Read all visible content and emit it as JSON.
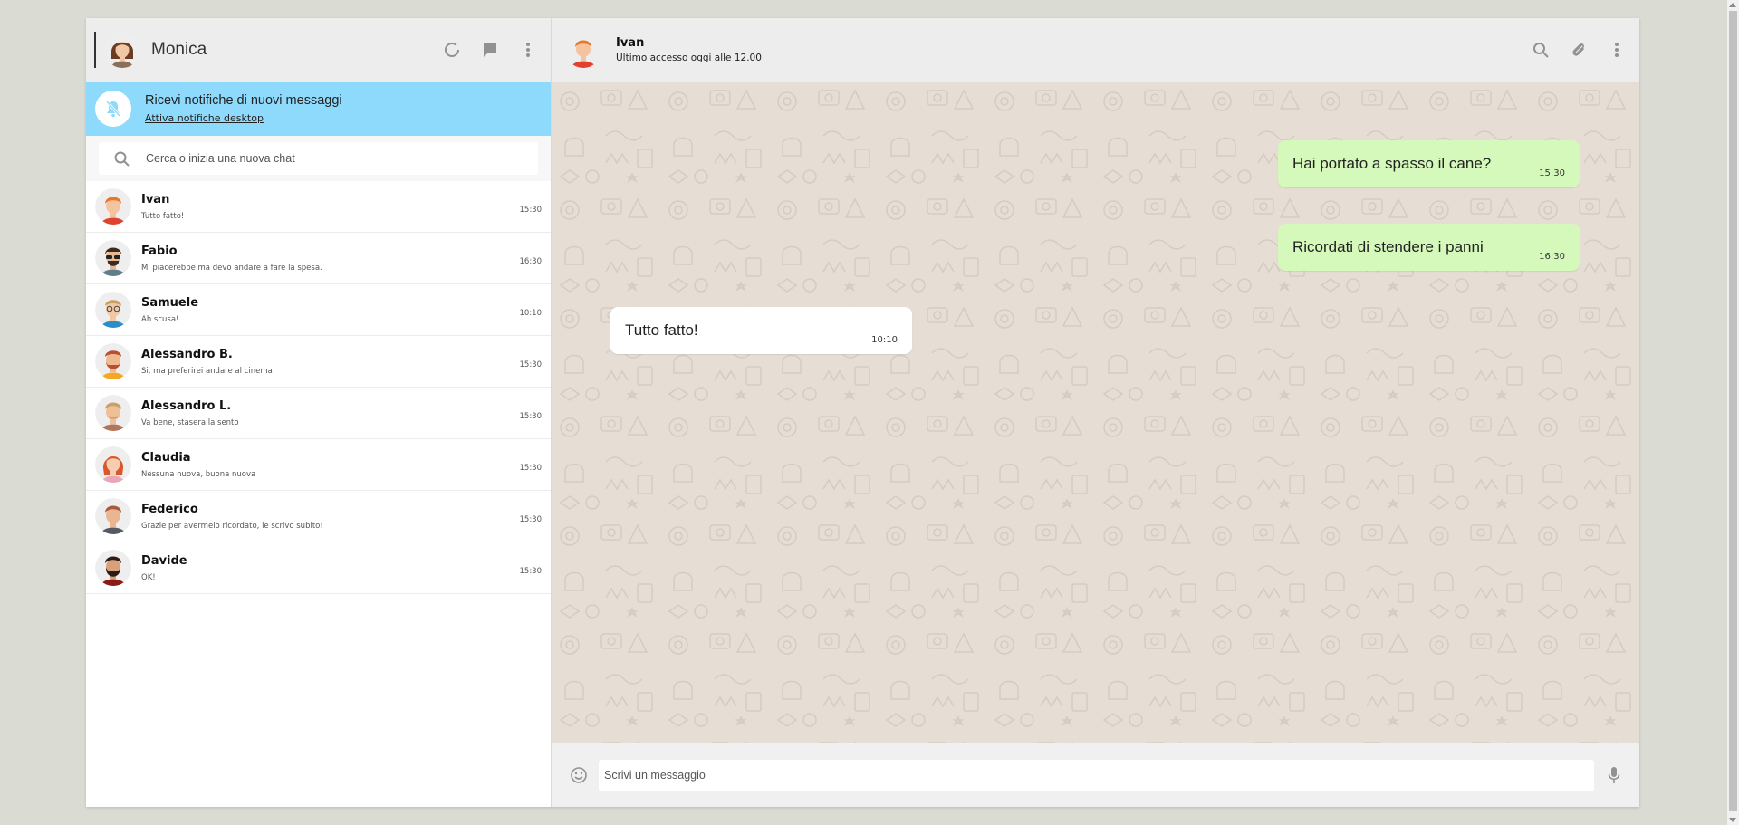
{
  "me": {
    "name": "Monica"
  },
  "notification": {
    "title": "Ricevi notifiche di nuovi messaggi",
    "link": "Attiva notifiche desktop"
  },
  "search": {
    "placeholder": "Cerca o inizia una nuova chat"
  },
  "chats": [
    {
      "name": "Ivan",
      "preview": "Tutto fatto!",
      "time": "15:30"
    },
    {
      "name": "Fabio",
      "preview": "Mi piacerebbe ma devo andare a fare la spesa.",
      "time": "16:30"
    },
    {
      "name": "Samuele",
      "preview": "Ah scusa!",
      "time": "10:10"
    },
    {
      "name": "Alessandro B.",
      "preview": "Si, ma preferirei andare al cinema",
      "time": "15:30"
    },
    {
      "name": "Alessandro L.",
      "preview": "Va bene, stasera la sento",
      "time": "15:30"
    },
    {
      "name": "Claudia",
      "preview": "Nessuna nuova, buona nuova",
      "time": "15:30"
    },
    {
      "name": "Federico",
      "preview": "Grazie per avermelo ricordato, le scrivo subito!",
      "time": "15:30"
    },
    {
      "name": "Davide",
      "preview": "OK!",
      "time": "15:30"
    }
  ],
  "active_chat": {
    "name": "Ivan",
    "status": "Ultimo accesso oggi alle 12.00",
    "messages": [
      {
        "text": "Hai portato a spasso il cane?",
        "time": "15:30",
        "type": "sent"
      },
      {
        "text": "Ricordati di stendere i panni",
        "time": "16:30",
        "type": "sent"
      },
      {
        "text": "Tutto fatto!",
        "time": "10:10",
        "type": "received"
      }
    ]
  },
  "composer": {
    "placeholder": "Scrivi un messaggio"
  },
  "icons": {
    "header_left": [
      "status-icon",
      "chat-icon",
      "menu-icon"
    ],
    "header_right": [
      "search-icon",
      "attach-icon",
      "menu-icon"
    ],
    "notification": "bell-off-icon",
    "composer_left": "emoji-icon",
    "composer_right": "mic-icon"
  },
  "colors": {
    "page_bg": "#dadbd3",
    "header_bg": "#ededed",
    "notification_bg": "#8edafc",
    "sent_bubble": "#d5f9ba",
    "received_bubble": "#ffffff",
    "chat_bg": "#e6ddd4"
  }
}
